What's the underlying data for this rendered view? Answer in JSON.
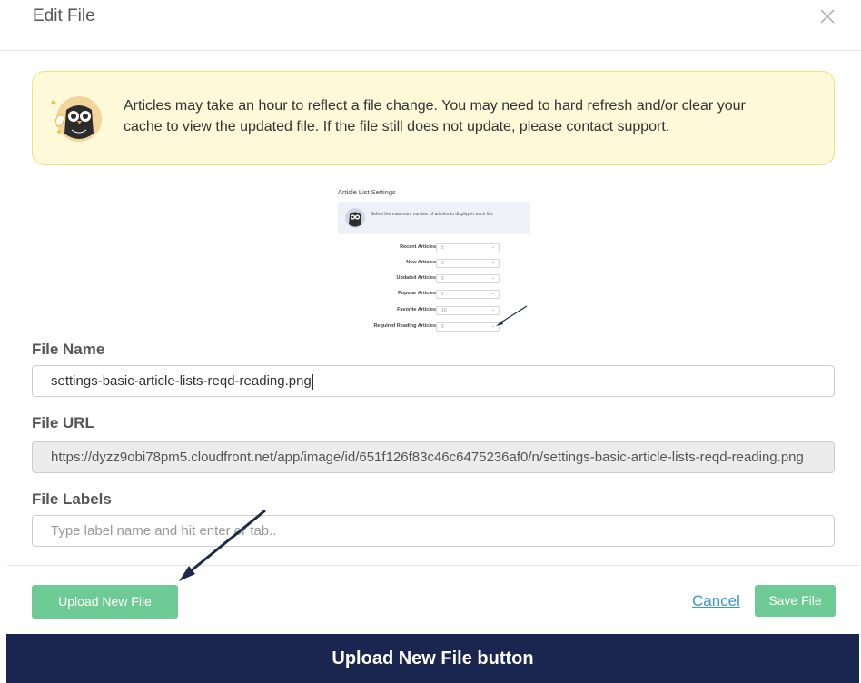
{
  "modal": {
    "title": "Edit File"
  },
  "alert": {
    "message": "Articles may take an hour to reflect a file change. You may need to hard refresh and/or clear your cache to view the updated file. If the file still does not update, please contact support."
  },
  "preview": {
    "title": "Article List Settings",
    "alert_text": "Select the maximum number of articles to display in each list.",
    "rows": [
      {
        "label": "Recent Articles",
        "value": "5"
      },
      {
        "label": "New Articles",
        "value": "5"
      },
      {
        "label": "Updated Articles",
        "value": "5"
      },
      {
        "label": "Popular Articles",
        "value": "5"
      },
      {
        "label": "Favorite Articles",
        "value": "10"
      },
      {
        "label": "Required Reading Articles",
        "value": "5"
      }
    ]
  },
  "form": {
    "file_name_label": "File Name",
    "file_name_value": "settings-basic-article-lists-reqd-reading.png",
    "file_url_label": "File URL",
    "file_url_value": "https://dyzz9obi78pm5.cloudfront.net/app/image/id/651f126f83c46c6475236af0/n/settings-basic-article-lists-reqd-reading.png",
    "file_labels_label": "File Labels",
    "file_labels_placeholder": "Type label name and hit enter or tab.."
  },
  "footer": {
    "upload_label": "Upload New File",
    "cancel_label": "Cancel",
    "save_label": "Save File"
  },
  "caption": {
    "text": "Upload New File button"
  },
  "colors": {
    "accent_green": "#6fcb95",
    "link_blue": "#3a97d4",
    "banner_navy": "#1a2550",
    "alert_bg": "#fdf9d9"
  }
}
